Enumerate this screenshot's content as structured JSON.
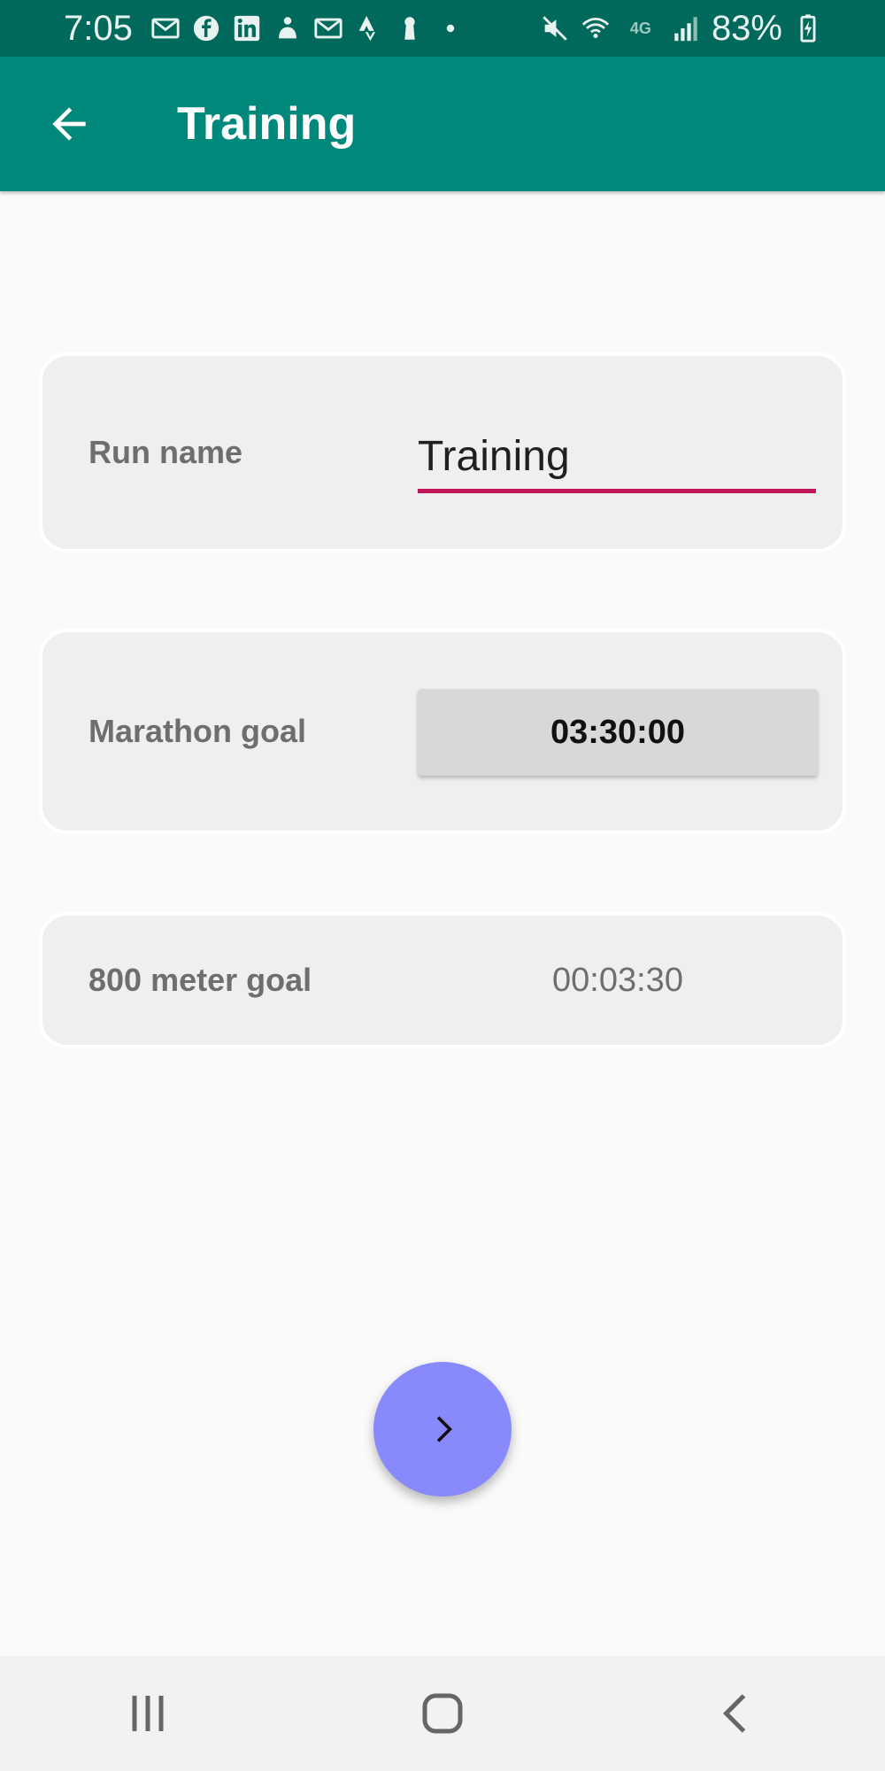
{
  "status_bar": {
    "time": "7:05",
    "battery": "83%",
    "network": "4G"
  },
  "app_bar": {
    "title": "Training",
    "back_icon": "arrow-back-icon"
  },
  "form": {
    "run_name": {
      "label": "Run name",
      "value": "Training"
    },
    "marathon_goal": {
      "label": "Marathon goal",
      "value": "03:30:00"
    },
    "meter_goal": {
      "label": "800 meter goal",
      "value": "00:03:30"
    }
  },
  "fab": {
    "icon": "chevron-right-icon"
  },
  "nav_bar": {
    "items": [
      "recent-apps-icon",
      "home-icon",
      "back-icon"
    ]
  },
  "colors": {
    "status_bar": "#00695c",
    "app_bar": "#00897b",
    "accent_underline": "#c2185b",
    "fab": "#8889fd",
    "card": "#efefef"
  }
}
